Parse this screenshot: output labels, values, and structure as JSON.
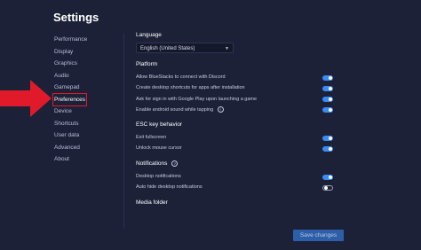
{
  "header": {
    "title": "Settings"
  },
  "sidebar": {
    "items": [
      {
        "label": "Performance"
      },
      {
        "label": "Display"
      },
      {
        "label": "Graphics"
      },
      {
        "label": "Audio"
      },
      {
        "label": "Gamepad"
      },
      {
        "label": "Preferences",
        "active": true
      },
      {
        "label": "Device"
      },
      {
        "label": "Shortcuts"
      },
      {
        "label": "User data"
      },
      {
        "label": "Advanced"
      },
      {
        "label": "About"
      }
    ]
  },
  "language": {
    "title": "Language",
    "selected": "English (United States)"
  },
  "platform": {
    "title": "Platform",
    "options": [
      {
        "label": "Allow BlueStacks to connect with Discord",
        "on": true
      },
      {
        "label": "Create desktop shortcuts for apps after installation",
        "on": true
      },
      {
        "label": "Ask for sign in with Google Play upon launching a game",
        "on": true
      },
      {
        "label": "Enable android sound while tapping",
        "on": true
      }
    ]
  },
  "esc": {
    "title": "ESC key behavior",
    "options": [
      {
        "label": "Exit fullscreen",
        "on": true
      },
      {
        "label": "Unlock mouse cursor",
        "on": true
      }
    ]
  },
  "notifications": {
    "title": "Notifications",
    "options": [
      {
        "label": "Desktop notifications",
        "on": true
      },
      {
        "label": "Auto hide desktop notifications",
        "on": false
      }
    ]
  },
  "media": {
    "title": "Media folder"
  },
  "footer": {
    "save_label": "Save changes"
  },
  "colors": {
    "background": "#1c2138",
    "accent": "#3a8bf5",
    "highlight": "#e01a2b"
  }
}
